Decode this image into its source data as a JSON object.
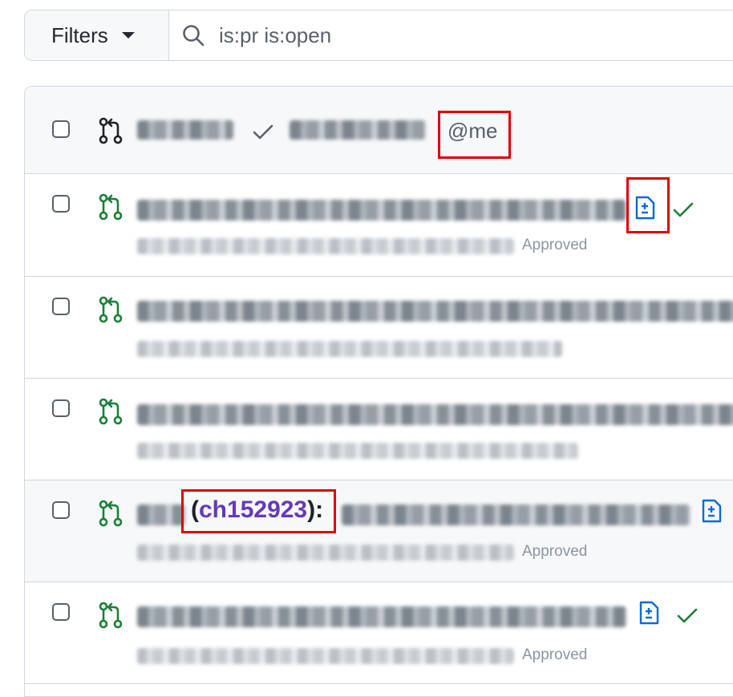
{
  "search": {
    "filters_label": "Filters",
    "query": "is:pr is:open"
  },
  "list_header": {
    "mention": "@me"
  },
  "rows": [
    {
      "status_text": "Approved",
      "has_file_icon": true,
      "has_check": true
    },
    {
      "status_text": "",
      "has_file_icon": false,
      "has_check": false
    },
    {
      "status_text": "",
      "has_file_icon": false,
      "has_check": false
    },
    {
      "issue_ref": "ch152923",
      "status_text": "Approved",
      "has_file_icon": true,
      "has_check": false
    },
    {
      "status_text": "Approved",
      "has_file_icon": true,
      "has_check": true
    }
  ],
  "colors": {
    "open_pr_green": "#1a7f37",
    "link_blue": "#0969da",
    "issue_purple": "#6639ba",
    "highlight_red": "#e00000"
  },
  "icons": [
    "search-icon",
    "caret-down-icon",
    "git-pull-request-icon",
    "file-diff-icon",
    "check-icon"
  ]
}
